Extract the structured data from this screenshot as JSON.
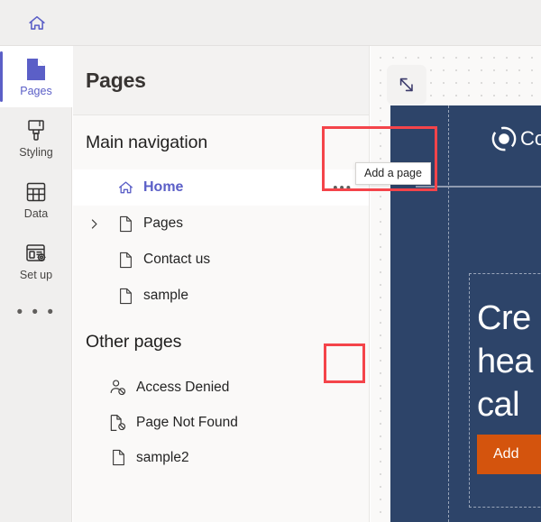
{
  "topbar": {
    "home_icon": "home-icon"
  },
  "rail": {
    "items": [
      {
        "label": "Pages",
        "icon": "page-filled-icon",
        "active": true
      },
      {
        "label": "Styling",
        "icon": "paintbrush-icon",
        "active": false
      },
      {
        "label": "Data",
        "icon": "table-icon",
        "active": false
      },
      {
        "label": "Set up",
        "icon": "setup-gear-icon",
        "active": false
      }
    ],
    "more_label": "• • •"
  },
  "panel": {
    "title": "Pages",
    "sections": [
      {
        "title": "Main navigation",
        "add_label": "+",
        "rows": [
          {
            "label": "Home",
            "icon": "home-outline-icon",
            "selected": true,
            "chevron": false,
            "dots": "•••"
          },
          {
            "label": "Pages",
            "icon": "page-outline-icon",
            "selected": false,
            "chevron": true,
            "dots": ""
          },
          {
            "label": "Contact us",
            "icon": "page-outline-icon",
            "selected": false,
            "chevron": false,
            "dots": ""
          },
          {
            "label": "sample",
            "icon": "page-outline-icon",
            "selected": false,
            "chevron": false,
            "dots": ""
          }
        ]
      },
      {
        "title": "Other pages",
        "add_label": "+",
        "rows": [
          {
            "label": "Access Denied",
            "icon": "person-blocked-icon",
            "selected": false,
            "chevron": false,
            "dots": ""
          },
          {
            "label": "Page Not Found",
            "icon": "page-blocked-icon",
            "selected": false,
            "chevron": false,
            "dots": ""
          },
          {
            "label": "sample2",
            "icon": "page-outline-icon",
            "selected": false,
            "chevron": false,
            "dots": ""
          }
        ]
      }
    ]
  },
  "tooltip": {
    "text": "Add a page"
  },
  "canvas": {
    "expand_icon": "expand-diagonal-icon",
    "site": {
      "logo_text": "Co",
      "hero_lines": [
        "Cre",
        "hea",
        "cal"
      ],
      "cta_label": "Add"
    }
  },
  "colors": {
    "accent_purple": "#5b5fc7",
    "highlight_red": "#f4444a",
    "site_navy": "#2d4469",
    "cta_orange": "#d4540d",
    "chrome_gray": "#f0efee"
  }
}
